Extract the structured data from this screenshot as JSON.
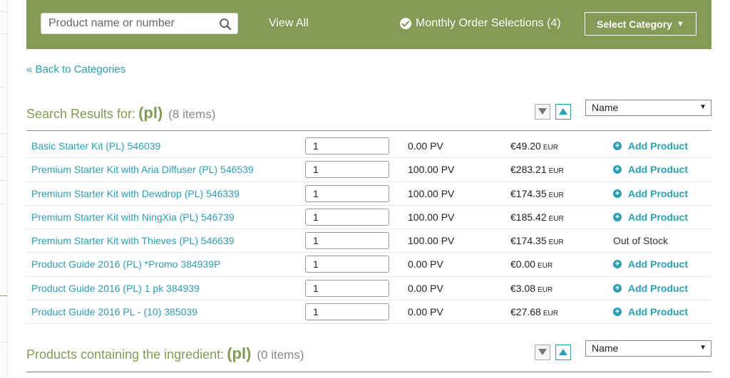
{
  "header": {
    "search_placeholder": "Product name or number",
    "view_all": "View All",
    "monthly_orders": "Monthly Order Selections (4)",
    "select_category": "Select Category"
  },
  "back_link": "« Back to Categories",
  "search_section": {
    "label": "Search Results for:",
    "term": "(pl)",
    "count": "(8 items)",
    "sort_value": "Name"
  },
  "ingredient_section": {
    "label": "Products containing the ingredient:",
    "term": "(pl)",
    "count": "(0 items)",
    "sort_value": "Name"
  },
  "products": [
    {
      "name": "Basic Starter Kit (PL) 546039",
      "qty": "1",
      "pv": "0.00 PV",
      "price": "€49.20",
      "currency": "EUR",
      "action": "Add Product"
    },
    {
      "name": "Premium Starter Kit with Aria Diffuser (PL) 546539",
      "qty": "1",
      "pv": "100.00 PV",
      "price": "€283.21",
      "currency": "EUR",
      "action": "Add Product"
    },
    {
      "name": "Premium Starter Kit with Dewdrop (PL) 546339",
      "qty": "1",
      "pv": "100.00 PV",
      "price": "€174.35",
      "currency": "EUR",
      "action": "Add Product"
    },
    {
      "name": "Premium Starter Kit with NingXia (PL) 546739",
      "qty": "1",
      "pv": "100.00 PV",
      "price": "€185.42",
      "currency": "EUR",
      "action": "Add Product"
    },
    {
      "name": "Premium Starter Kit with Thieves (PL) 546639",
      "qty": "1",
      "pv": "100.00 PV",
      "price": "€174.35",
      "currency": "EUR",
      "status": "Out of Stock"
    },
    {
      "name": "Product Guide 2016 (PL) *Promo 384939P",
      "qty": "1",
      "pv": "0.00 PV",
      "price": "€0.00",
      "currency": "EUR",
      "action": "Add Product"
    },
    {
      "name": "Product Guide 2016 (PL) 1 pk 384939",
      "qty": "1",
      "pv": "0.00 PV",
      "price": "€3.08",
      "currency": "EUR",
      "action": "Add Product"
    },
    {
      "name": "Product Guide 2016 PL - (10) 385039",
      "qty": "1",
      "pv": "0.00 PV",
      "price": "€27.68",
      "currency": "EUR",
      "action": "Add Product"
    }
  ],
  "colors": {
    "header_bg": "#839b55",
    "link": "#2a9fb2",
    "section_title": "#839b55"
  }
}
